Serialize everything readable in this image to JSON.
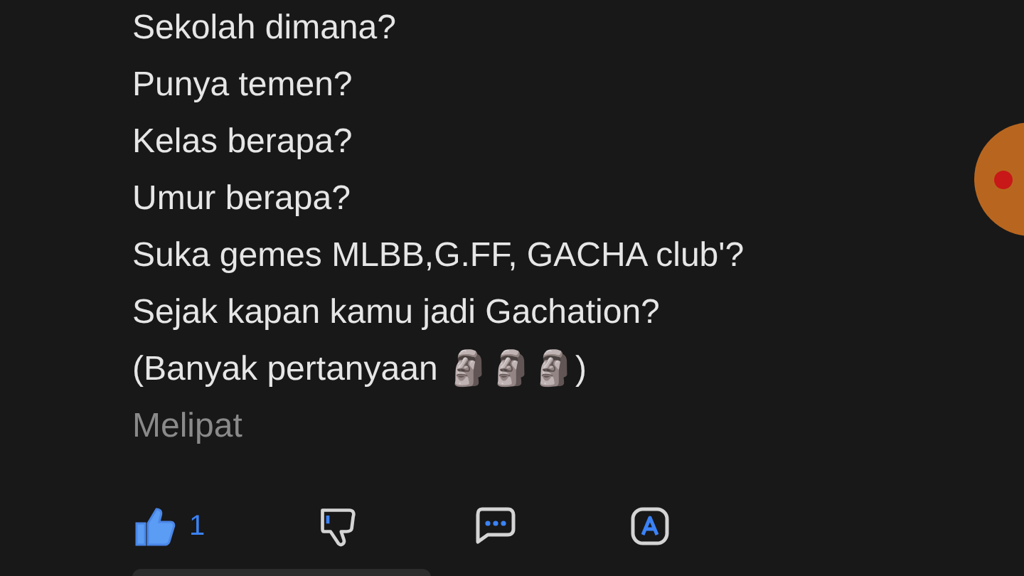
{
  "comment": {
    "lines": [
      "Sekolah dimana?",
      "Punya temen?",
      "Kelas berapa?",
      "Umur berapa?",
      "Suka gemes MLBB,G.FF, GACHA club'?",
      "Sejak kapan kamu jadi Gachation?",
      "(Banyak pertanyaan 🗿🗿🗿)"
    ],
    "collapse_link": "Melipat"
  },
  "actions": {
    "like": {
      "count": "1",
      "selected": true
    },
    "dislike": {
      "selected": false
    }
  }
}
